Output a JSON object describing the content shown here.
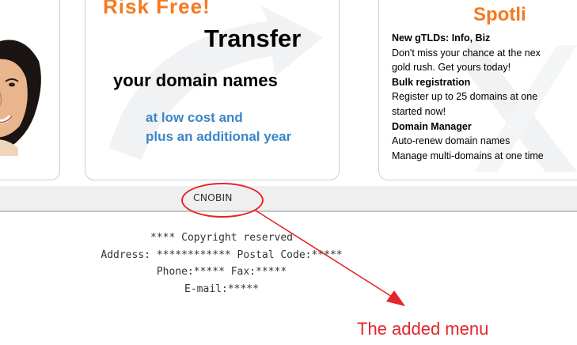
{
  "banner": {
    "mid": {
      "headline_partial": "Risk Free!",
      "title": "Transfer",
      "subtitle": "your domain names",
      "line1": "at low cost and",
      "line2": "plus an additional year"
    },
    "right": {
      "title": "Spotli",
      "items": [
        {
          "kind": "head",
          "text": "New gTLDs: Info, Biz"
        },
        {
          "kind": "text",
          "text": "Don't miss your chance at the nex"
        },
        {
          "kind": "text",
          "text": "gold rush. Get yours today!"
        },
        {
          "kind": "head",
          "text": "Bulk registration"
        },
        {
          "kind": "text",
          "text": "Register up to 25   domains at one"
        },
        {
          "kind": "text",
          "text": " started now!"
        },
        {
          "kind": "head",
          "text": "Domain Manager"
        },
        {
          "kind": "text",
          "text": "Auto-renew domain names"
        },
        {
          "kind": "text",
          "text": "Manage multi-domains at one time"
        }
      ]
    }
  },
  "menu": {
    "item_label": "CNOBIN"
  },
  "footer": {
    "copyright": "**** Copyright reserved",
    "address": "Address: ************ Postal Code:*****",
    "phone": "Phone:***** Fax:*****",
    "email": "E-mail:*****"
  },
  "annotation": {
    "label": "The added menu",
    "color": "#e3262a"
  },
  "colors": {
    "accent_orange": "#f47a20",
    "promo_blue": "#3a86c8",
    "menu_bg": "#efefef"
  }
}
